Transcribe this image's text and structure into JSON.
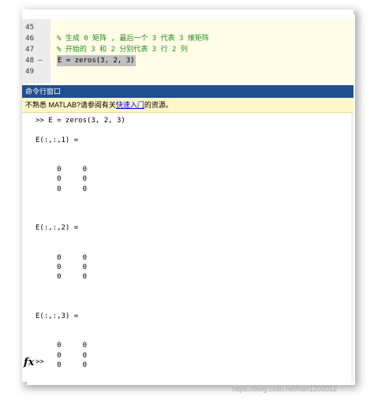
{
  "editor": {
    "lines": [
      {
        "num": "45",
        "dash": "",
        "text": "",
        "kind": "normal"
      },
      {
        "num": "46",
        "dash": "",
        "text": "% 生成 0 矩阵 , 最后一个 3 代表 3 维矩阵",
        "kind": "comment"
      },
      {
        "num": "47",
        "dash": "",
        "text": "% 开始的 3 和 2 分别代表 3 行 2 列",
        "kind": "comment"
      },
      {
        "num": "48",
        "dash": "–",
        "text": "E = zeros(3, 2, 3)",
        "kind": "selected"
      },
      {
        "num": "49",
        "dash": "",
        "text": "",
        "kind": "normal"
      }
    ]
  },
  "command_window": {
    "title": "命令行窗口",
    "notice_before": "不熟悉 MATLAB?请参阅有关",
    "notice_link": "快速入门",
    "notice_after": "的资源。",
    "output": [
      ">> E = zeros(3, 2, 3)",
      "",
      "E(:,:,1) =",
      "",
      "",
      "     0     0",
      "     0     0",
      "     0     0",
      "",
      "",
      "",
      "E(:,:,2) =",
      "",
      "",
      "     0     0",
      "     0     0",
      "     0     0",
      "",
      "",
      "",
      "E(:,:,3) =",
      "",
      "",
      "     0     0",
      "     0     0",
      "     0     0"
    ],
    "fx_symbol": "fx",
    "prompt": ">>"
  },
  "watermark": "https://blog.csdn.net/han1202012"
}
